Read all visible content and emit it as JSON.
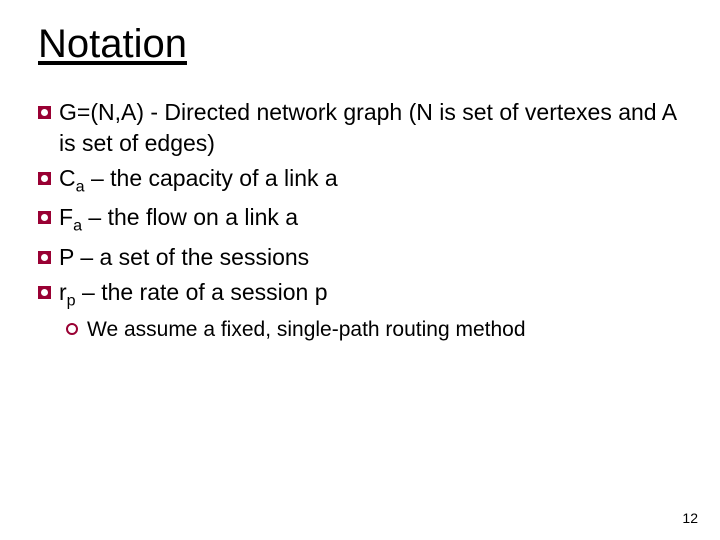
{
  "title": "Notation",
  "items": [
    {
      "html": "G=(N,A) - Directed network graph (N is set of vertexes and A is set of edges)"
    },
    {
      "html": "C<sub>a</sub> – the capacity of a link a"
    },
    {
      "html": "F<sub>a</sub> – the flow on a link a"
    },
    {
      "html": "P  – a set of the sessions"
    },
    {
      "html": "r<sub>p</sub>  – the rate of a session p"
    }
  ],
  "subitem": "We assume a fixed, single-path routing method",
  "page_number": "12"
}
